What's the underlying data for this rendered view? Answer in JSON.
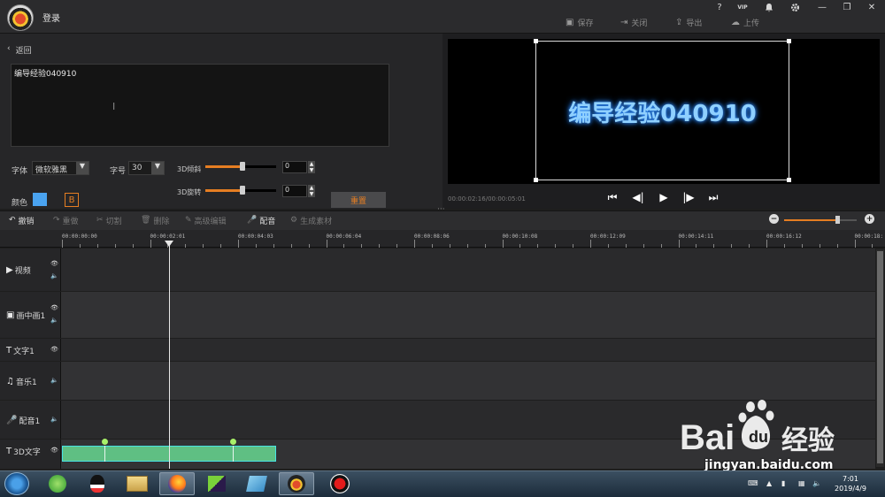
{
  "header": {
    "login_label": "登录",
    "window_controls": {
      "help": "?",
      "vip": "VIP",
      "bell": "bell",
      "gear": "gear",
      "minimize": "—",
      "restore": "❐",
      "close": "✕"
    },
    "actions": {
      "save": "保存",
      "close": "关闭",
      "export": "导出",
      "upload": "上传"
    }
  },
  "editor": {
    "back_label": "返回",
    "text_value": "编导经验040910",
    "font_label": "字体",
    "font_value": "微软雅黑",
    "size_label": "字号",
    "size_value": "30",
    "tilt_label": "3D倾斜",
    "tilt_value": "0",
    "rotate_label": "3D旋转",
    "rotate_value": "0",
    "color_label": "颜色",
    "color_value": "#4aa3f0",
    "bold_label": "B",
    "reset_label": "重置",
    "tilt_fraction": 0.52,
    "rotate_fraction": 0.52
  },
  "preview": {
    "text": "编导经验040910",
    "timecode": "00:00:02:16/00:00:05:01",
    "controls": [
      "skip-start",
      "prev-frame",
      "play",
      "next-frame",
      "skip-end"
    ]
  },
  "toolbar": {
    "undo": "撤销",
    "redo": "重做",
    "cut": "切割",
    "delete": "删除",
    "advanced": "高级编辑",
    "dub": "配音",
    "generate": "生成素材",
    "zoom_fraction": 0.73
  },
  "timeline": {
    "ticks": [
      "00:00:00:00",
      "00:00:02:01",
      "00:00:04:03",
      "00:00:06:04",
      "00:00:08:06",
      "00:00:10:08",
      "00:00:12:09",
      "00:00:14:11",
      "00:00:16:12",
      "00:00:18:"
    ],
    "tracks": [
      {
        "name": "视频"
      },
      {
        "name": "画中画1"
      },
      {
        "name": "文字1"
      },
      {
        "name": "音乐1"
      },
      {
        "name": "配音1"
      },
      {
        "name": "3D文字"
      }
    ]
  },
  "watermark": {
    "brand": "Bai",
    "brand2": "du",
    "sub": "经验",
    "url": "jingyan.baidu.com"
  },
  "taskbar": {
    "time": "7:01",
    "date": "2019/4/9"
  }
}
